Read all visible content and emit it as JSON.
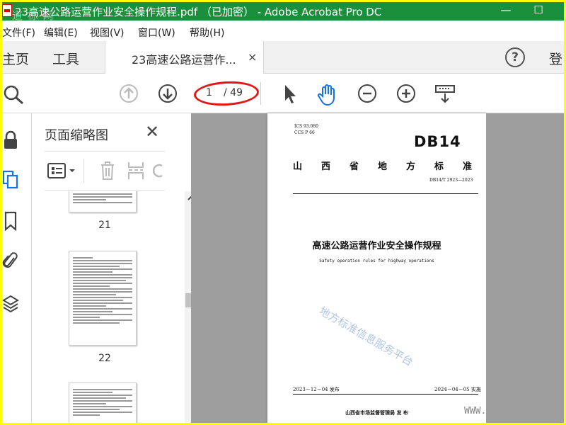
{
  "window": {
    "title": "23高速公路运营作业安全操作规程.pdf （已加密） - Adobe Acrobat Pro DC",
    "watermark": "道 标 网",
    "minimize_glyph": "—",
    "maximize_glyph": "☐"
  },
  "menu": [
    "文件(F)",
    "编辑(E)",
    "视图(V)",
    "窗口(W)",
    "帮助(H)"
  ],
  "tabs": {
    "home": "主页",
    "tools": "工具",
    "document": "23高速公路运营作...",
    "close_glyph": "×",
    "help_glyph": "?",
    "login": "登"
  },
  "toolbar": {
    "current_page": "1",
    "total_pages": "/ 49"
  },
  "thumbnail_panel": {
    "title": "页面缩略图",
    "close_glyph": "✕",
    "thumbnails": [
      {
        "number": "21"
      },
      {
        "number": "22"
      }
    ]
  },
  "document": {
    "ics": "ICS  93.080",
    "ccs": "CCS  P 66",
    "code": "DB14",
    "province": "山西省地方标准",
    "standard_no": "DB14/T 2923—2023",
    "title_cn": "高速公路运营作业安全操作规程",
    "title_en": "Safety operation rules for highway operations",
    "issue_date": "2023－12－04 发布",
    "impl_date": "2024－04－05 实施",
    "issuer": "山西省市场监督管理局    发 布",
    "stamp": "地方标准信息服务平台",
    "watermark_url": "WWW. "
  },
  "colors": {
    "titlebar": "#1a8f3c",
    "border": "#ffff00",
    "accent_blue": "#1473e6",
    "oval": "#e01818",
    "viewer_bg": "#9e9e9e"
  },
  "icons": [
    "pdf-icon",
    "search-zoom-icon",
    "arrow-up-icon",
    "arrow-down-icon",
    "select-cursor-icon",
    "hand-icon",
    "zoom-out-icon",
    "zoom-in-icon",
    "scan-icon",
    "lock-icon",
    "pages-icon",
    "bookmark-icon",
    "attachment-icon",
    "layers-icon",
    "options-icon",
    "trash-icon",
    "extract-icon",
    "rotate-icon"
  ]
}
